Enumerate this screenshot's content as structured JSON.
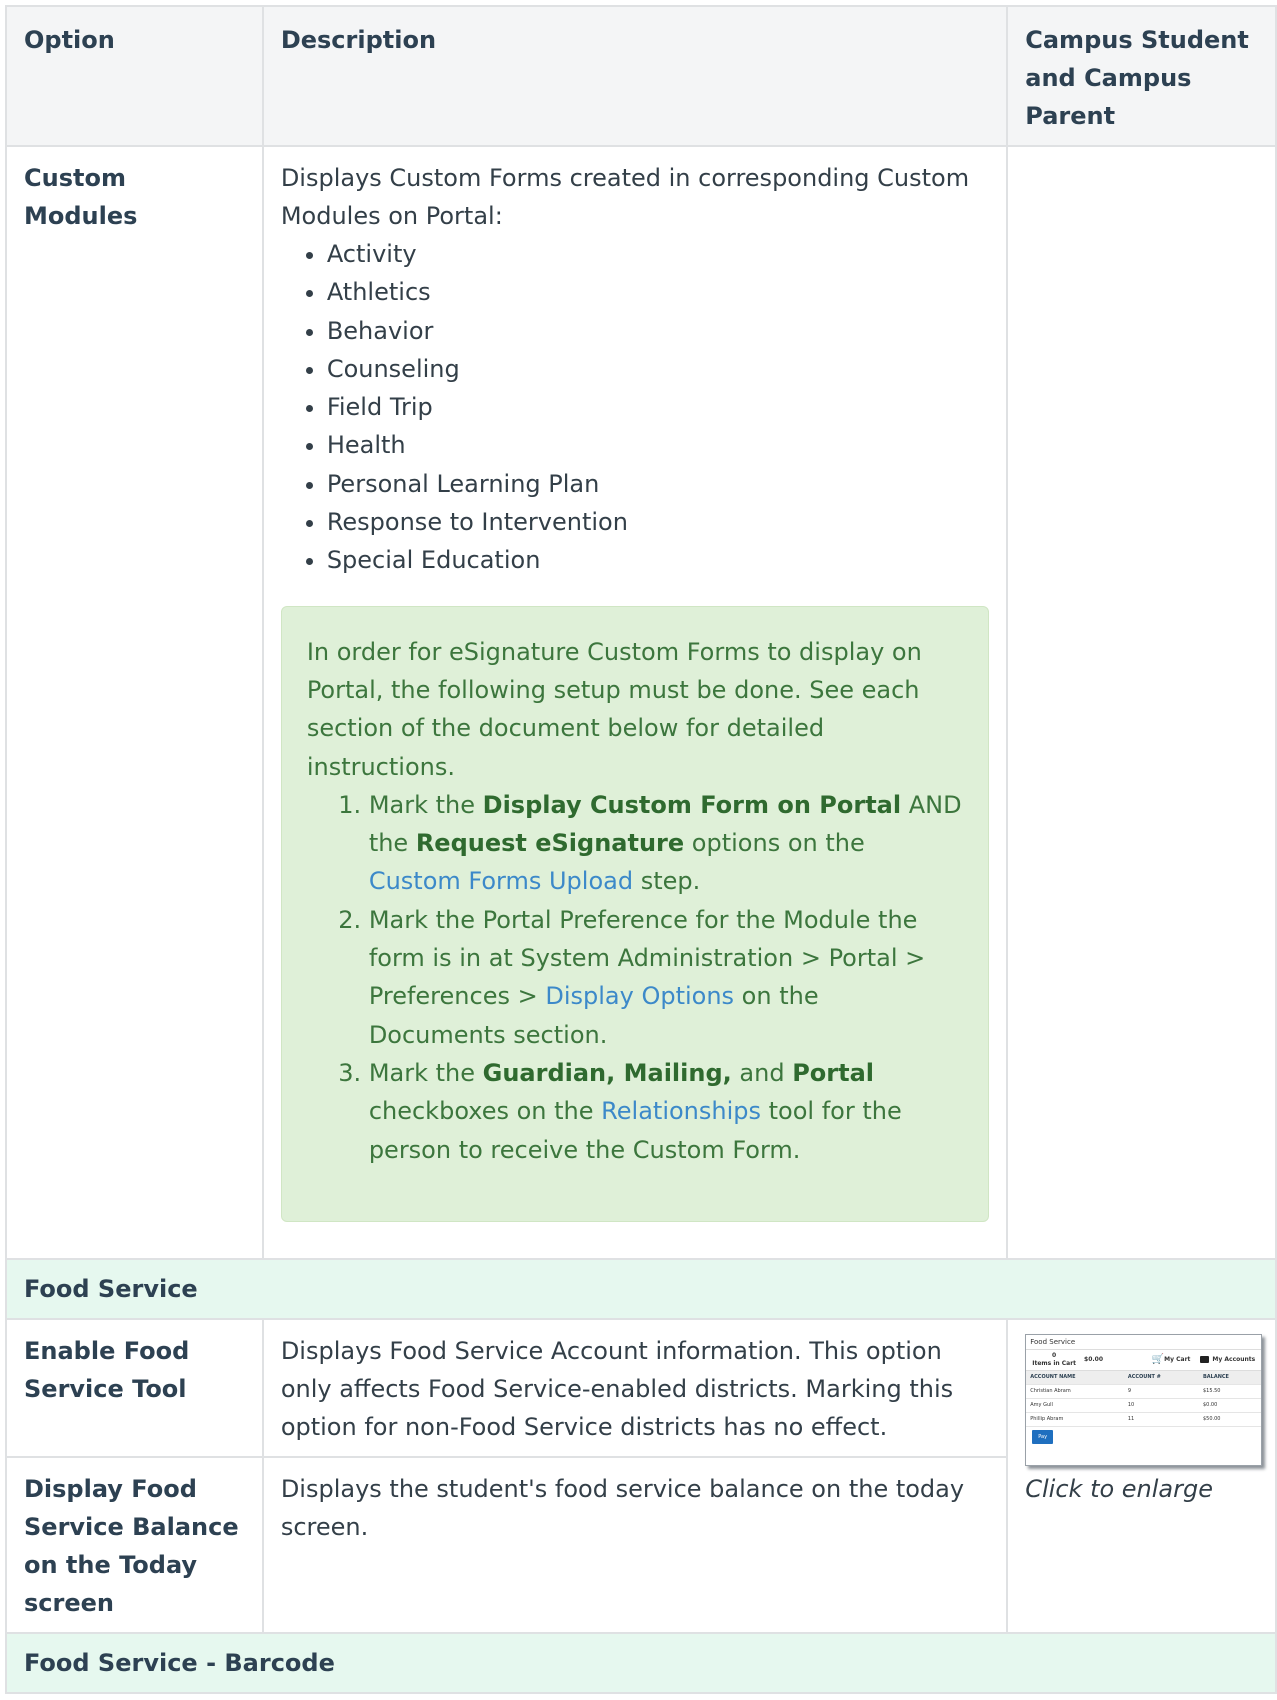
{
  "headers": {
    "option": "Option",
    "description": "Description",
    "campus": "Campus Student and Campus Parent"
  },
  "custom_modules": {
    "option": "Custom Modules",
    "intro": "Displays Custom Forms created in corresponding Custom Modules on Portal:",
    "modules": [
      "Activity",
      "Athletics",
      "Behavior",
      "Counseling",
      "Field Trip",
      "Health",
      "Personal Learning Plan",
      "Response to Intervention",
      "Special Education"
    ],
    "note": {
      "intro": "In order for eSignature Custom Forms to display on Portal, the following setup must be done. See each section of the document below for detailed instructions.",
      "step1": {
        "a": "Mark the ",
        "b1": "Display Custom Form on Portal",
        "c": " AND the ",
        "b2": "Request eSignature",
        "d": " options on the ",
        "link": "Custom Forms Upload",
        "e": " step."
      },
      "step2": {
        "a": "Mark the Portal Preference for the Module the form is in at System Administration > Portal > Preferences > ",
        "link": "Display Options",
        "b": " on the Documents section."
      },
      "step3": {
        "a": "Mark the ",
        "b1": "Guardian, Mailing,",
        "c": " and ",
        "b2": "Portal",
        "d": " checkboxes on the ",
        "link": "Relationships",
        "e": " tool for the person to receive the Custom Form."
      }
    }
  },
  "food_service": {
    "section": "Food Service",
    "enable_option": "Enable Food Service Tool",
    "enable_desc": "Displays Food Service Account information. This option only affects Food Service-enabled districts. Marking this option for non-Food Service districts has no effect.",
    "balance_option": "Display Food Service Balance on the Today screen",
    "balance_desc": "Displays the student's food service balance on the today screen.",
    "caption": "Click to enlarge",
    "thumb": {
      "title": "Food Service",
      "items_count": "0",
      "items_label": "Items in Cart",
      "total": "$0.00",
      "my_cart": "My Cart",
      "my_accounts": "My Accounts",
      "columns": [
        "ACCOUNT NAME",
        "ACCOUNT #",
        "BALANCE"
      ],
      "rows": [
        [
          "Christian Abram",
          "9",
          "$15.50"
        ],
        [
          "Amy Gull",
          "10",
          "$0.00"
        ],
        [
          "Phillip Abram",
          "11",
          "$50.00"
        ]
      ],
      "pay": "Pay"
    }
  },
  "barcode_section": "Food Service - Barcode"
}
